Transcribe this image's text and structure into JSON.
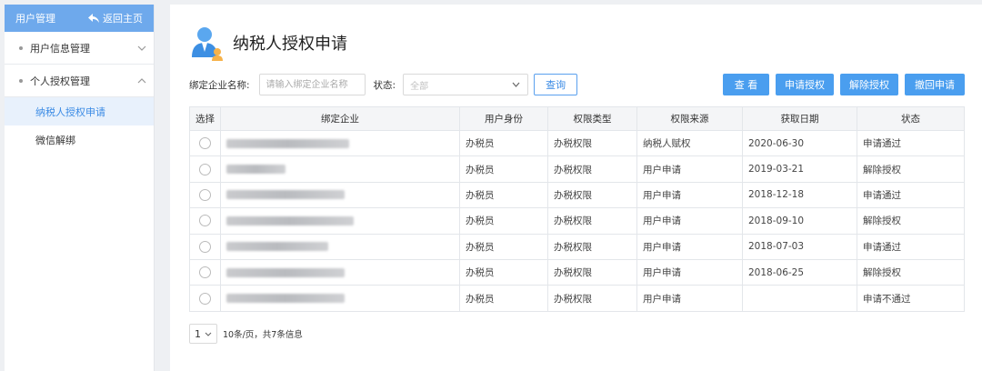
{
  "sidebar": {
    "header_title": "用户管理",
    "back_label": "返回主页",
    "groups": [
      {
        "label": "用户信息管理"
      },
      {
        "label": "个人授权管理"
      }
    ],
    "items": [
      {
        "label": "纳税人授权申请",
        "active": true
      },
      {
        "label": "微信解绑",
        "active": false
      }
    ]
  },
  "main": {
    "title": "纳税人授权申请",
    "filter": {
      "company_label": "绑定企业名称:",
      "company_placeholder": "请输入绑定企业名称",
      "status_label": "状态:",
      "status_value": "全部",
      "query_label": "查询"
    },
    "actions": [
      "查 看",
      "申请授权",
      "解除授权",
      "撤回申请"
    ]
  },
  "table": {
    "columns": [
      "选择",
      "绑定企业",
      "用户身份",
      "权限类型",
      "权限来源",
      "获取日期",
      "状态"
    ],
    "rows": [
      {
        "company": "",
        "identity": "办税员",
        "perm_type": "办税权限",
        "source": "纳税人赋权",
        "date": "2020-06-30",
        "status": "申请通过"
      },
      {
        "company": "",
        "identity": "办税员",
        "perm_type": "办税权限",
        "source": "用户申请",
        "date": "2019-03-21",
        "status": "解除授权"
      },
      {
        "company": "",
        "identity": "办税员",
        "perm_type": "办税权限",
        "source": "用户申请",
        "date": "2018-12-18",
        "status": "申请通过"
      },
      {
        "company": "",
        "identity": "办税员",
        "perm_type": "办税权限",
        "source": "用户申请",
        "date": "2018-09-10",
        "status": "解除授权"
      },
      {
        "company": "",
        "identity": "办税员",
        "perm_type": "办税权限",
        "source": "用户申请",
        "date": "2018-07-03",
        "status": "申请通过"
      },
      {
        "company": "",
        "identity": "办税员",
        "perm_type": "办税权限",
        "source": "用户申请",
        "date": "2018-06-25",
        "status": "解除授权"
      },
      {
        "company": "",
        "identity": "办税员",
        "perm_type": "办税权限",
        "source": "用户申请",
        "date": "",
        "status": "申请不通过"
      }
    ]
  },
  "pager": {
    "page": "1",
    "info": "10条/页，共7条信息"
  },
  "colors": {
    "accent": "#4a9eef",
    "sidebar_header": "#6ea9ec",
    "active_item_bg": "#e8f1fc",
    "active_item_text": "#3b8be5"
  },
  "icons": [
    "back-arrow-icon",
    "chevron-down-icon",
    "user-avatar-icon"
  ]
}
